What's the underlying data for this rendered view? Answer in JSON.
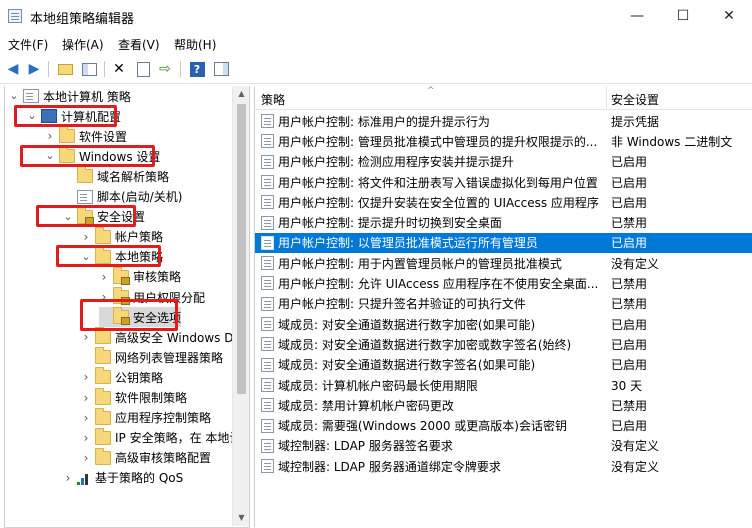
{
  "window": {
    "title": "本地组策略编辑器",
    "controls": {
      "minimize": "—",
      "maximize": "☐",
      "close": "✕"
    }
  },
  "menu": [
    "文件(F)",
    "操作(A)",
    "查看(V)",
    "帮助(H)"
  ],
  "toolbar": [
    "back-arrow-icon",
    "forward-arrow-icon",
    "up-folder-icon",
    "show-hide-tree-icon",
    "delete-icon",
    "properties-icon",
    "export-list-icon",
    "help-icon",
    "show-action-pane-icon"
  ],
  "tree": {
    "items": [
      {
        "label": "本地计算机 策略",
        "level": 0,
        "icon": "doc",
        "expanded": true
      },
      {
        "label": "计算机配置",
        "level": 1,
        "icon": "pc",
        "expanded": true,
        "highlight": true
      },
      {
        "label": "软件设置",
        "level": 2,
        "icon": "folder",
        "expanded": false
      },
      {
        "label": "Windows 设置",
        "level": 2,
        "icon": "folder",
        "expanded": true,
        "highlight": true
      },
      {
        "label": "域名解析策略",
        "level": 3,
        "icon": "folder",
        "expanded": null
      },
      {
        "label": "脚本(启动/关机)",
        "level": 3,
        "icon": "doc",
        "expanded": null
      },
      {
        "label": "安全设置",
        "level": 3,
        "icon": "lockfolder",
        "expanded": true,
        "highlight": true
      },
      {
        "label": "帐户策略",
        "level": 4,
        "icon": "folder",
        "expanded": false
      },
      {
        "label": "本地策略",
        "level": 4,
        "icon": "folder",
        "expanded": true,
        "highlight": true
      },
      {
        "label": "审核策略",
        "level": 5,
        "icon": "lockfolder",
        "expanded": false
      },
      {
        "label": "用户权限分配",
        "level": 5,
        "icon": "lockfolder",
        "expanded": false
      },
      {
        "label": "安全选项",
        "level": 5,
        "icon": "lockfolder",
        "expanded": null,
        "highlight": true,
        "selected": true
      },
      {
        "label": "高级安全 Windows Def",
        "level": 4,
        "icon": "folder",
        "expanded": false
      },
      {
        "label": "网络列表管理器策略",
        "level": 4,
        "icon": "folder",
        "expanded": null
      },
      {
        "label": "公钥策略",
        "level": 4,
        "icon": "folder",
        "expanded": false
      },
      {
        "label": "软件限制策略",
        "level": 4,
        "icon": "folder",
        "expanded": false
      },
      {
        "label": "应用程序控制策略",
        "level": 4,
        "icon": "folder",
        "expanded": false
      },
      {
        "label": "IP 安全策略，在 本地计",
        "level": 4,
        "icon": "folder",
        "expanded": false
      },
      {
        "label": "高级审核策略配置",
        "level": 4,
        "icon": "folder",
        "expanded": false
      },
      {
        "label": "基于策略的 QoS",
        "level": 3,
        "icon": "chart",
        "expanded": false
      }
    ]
  },
  "list": {
    "columns": {
      "policy": "策略",
      "setting": "安全设置"
    },
    "rows": [
      {
        "name": "用户帐户控制: 标准用户的提升提示行为",
        "value": "提示凭据"
      },
      {
        "name": "用户帐户控制: 管理员批准模式中管理员的提升权限提示的...",
        "value": "非 Windows 二进制文"
      },
      {
        "name": "用户帐户控制: 检测应用程序安装并提示提升",
        "value": "已启用"
      },
      {
        "name": "用户帐户控制: 将文件和注册表写入错误虚拟化到每用户位置",
        "value": "已启用"
      },
      {
        "name": "用户帐户控制: 仅提升安装在安全位置的 UIAccess 应用程序",
        "value": "已启用"
      },
      {
        "name": "用户帐户控制: 提示提升时切换到安全桌面",
        "value": "已禁用"
      },
      {
        "name": "用户帐户控制: 以管理员批准模式运行所有管理员",
        "value": "已启用",
        "selected": true
      },
      {
        "name": "用户帐户控制: 用于内置管理员帐户的管理员批准模式",
        "value": "没有定义"
      },
      {
        "name": "用户帐户控制: 允许 UIAccess 应用程序在不使用安全桌面...",
        "value": "已禁用"
      },
      {
        "name": "用户帐户控制: 只提升签名并验证的可执行文件",
        "value": "已禁用"
      },
      {
        "name": "域成员: 对安全通道数据进行数字加密(如果可能)",
        "value": "已启用"
      },
      {
        "name": "域成员: 对安全通道数据进行数字加密或数字签名(始终)",
        "value": "已启用"
      },
      {
        "name": "域成员: 对安全通道数据进行数字签名(如果可能)",
        "value": "已启用"
      },
      {
        "name": "域成员: 计算机帐户密码最长使用期限",
        "value": "30 天"
      },
      {
        "name": "域成员: 禁用计算机帐户密码更改",
        "value": "已禁用"
      },
      {
        "name": "域成员: 需要强(Windows 2000 或更高版本)会话密钥",
        "value": "已启用"
      },
      {
        "name": "域控制器: LDAP 服务器签名要求",
        "value": "没有定义"
      },
      {
        "name": "域控制器: LDAP 服务器通道绑定令牌要求",
        "value": "没有定义"
      }
    ]
  },
  "colors": {
    "selection": "#0078d7",
    "highlight_box": "#e21b1b"
  }
}
